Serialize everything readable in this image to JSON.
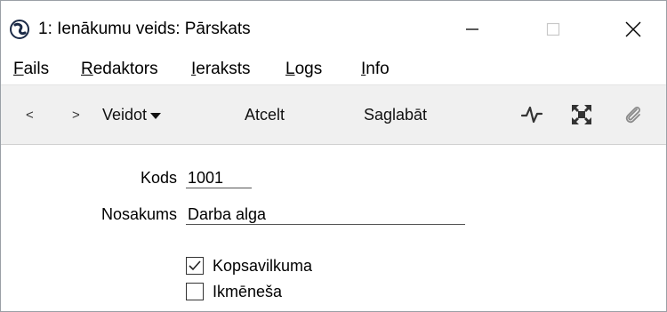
{
  "window": {
    "title": "1: Ienākumu veids: Pārskats",
    "controls": {
      "minimize_icon": "minimize-icon",
      "maximize_icon": "maximize-icon",
      "close_icon": "close-icon"
    }
  },
  "menu": {
    "items": [
      {
        "label": "Fails"
      },
      {
        "label": "Redaktors"
      },
      {
        "label": "Ieraksts"
      },
      {
        "label": "Logs"
      },
      {
        "label": "Info"
      }
    ]
  },
  "toolbar": {
    "prev_label": "<",
    "next_label": ">",
    "create_label": "Veidot",
    "cancel_label": "Atcelt",
    "save_label": "Saglabāt",
    "icons": [
      "activity-icon",
      "fullscreen-icon",
      "paperclip-icon"
    ]
  },
  "form": {
    "code_label": "Kods",
    "code_value": "1001",
    "name_label": "Nosakums",
    "name_value": "Darba alga",
    "checkboxes": [
      {
        "label": "Kopsavilkuma",
        "checked": true
      },
      {
        "label": "Ikmēneša",
        "checked": false
      }
    ]
  },
  "colors": {
    "toolbar_bg": "#f0f0f0",
    "window_bg": "#ffffff",
    "icon_dark": "#333333"
  }
}
